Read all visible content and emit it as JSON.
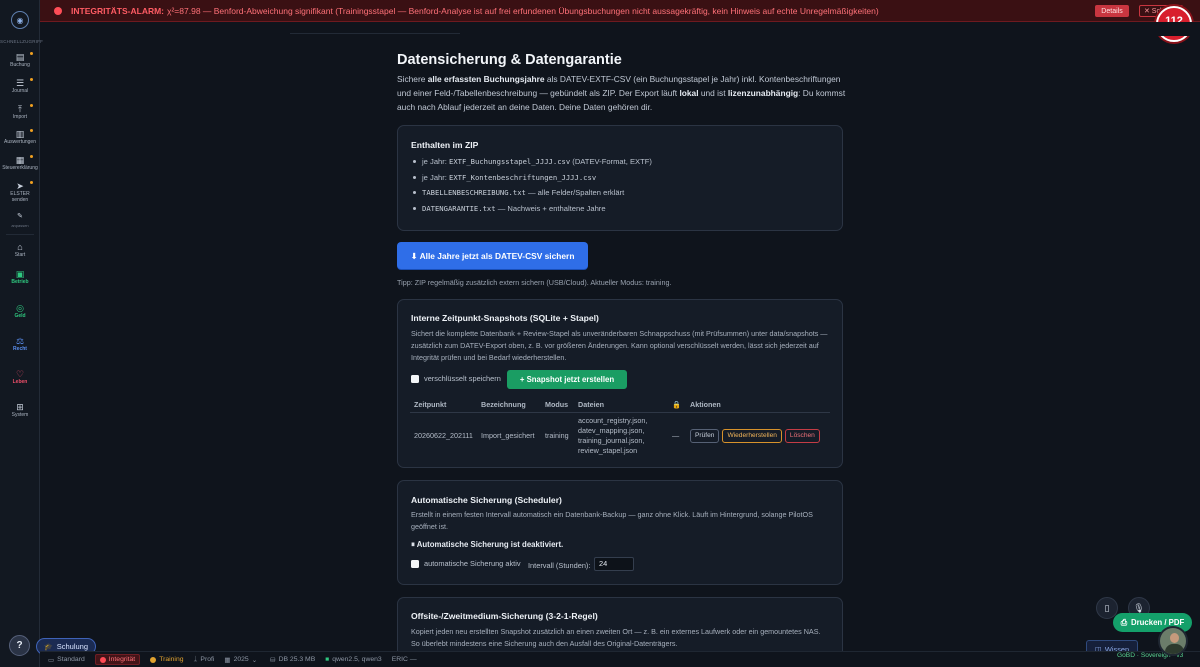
{
  "alarm": {
    "title": "INTEGRITÄTS-ALARM:",
    "message": "χ²=87.98 — Benford-Abweichung signifikant (Trainingsstapel — Benford-Analyse ist auf frei erfundenen Übungsbuchungen nicht aussagekräftig, kein Hinweis auf echte Unregelmäßigkeiten)",
    "details_label": "Details",
    "close_label": "✕ Schließen",
    "accent": "#ff4d57"
  },
  "notruf": {
    "number": "112",
    "label": "Notruf"
  },
  "sidebar": {
    "header": "SCHNELLZUGRIFF",
    "quick_items": [
      {
        "label": "Buchung",
        "icon": "document-icon"
      },
      {
        "label": "Journal",
        "icon": "list-icon"
      },
      {
        "label": "Import",
        "icon": "upload-icon"
      },
      {
        "label": "Auswertungen",
        "icon": "chart-icon"
      },
      {
        "label": "Steuererklärung",
        "icon": "form-icon"
      },
      {
        "label": "ELSTER senden",
        "icon": "send-icon"
      },
      {
        "label": "anpassen",
        "icon": "pencil-icon"
      }
    ],
    "nav_items": [
      {
        "label": "Start",
        "icon": "home-icon"
      },
      {
        "label": "Betrieb",
        "icon": "briefcase-icon",
        "color": "#2fc77f"
      },
      {
        "label": "Geld",
        "icon": "money-icon",
        "color": "#2fc77f"
      },
      {
        "label": "Recht",
        "icon": "scale-icon",
        "color": "#5b8ff0"
      },
      {
        "label": "Leben",
        "icon": "heart-pulse-icon",
        "color": "#ef4f6a"
      },
      {
        "label": "System",
        "icon": "grid-icon"
      }
    ]
  },
  "help_label": "?",
  "schulung_label": "Schulung",
  "page": {
    "title": "Datensicherung & Datengarantie",
    "intro_1": "Sichere ",
    "intro_b1": "alle erfassten Buchungsjahre",
    "intro_2": " als DATEV-EXTF-CSV (ein Buchungsstapel je Jahr) inkl. Kontenbeschriftungen und einer Feld-/Tabellenbeschreibung — gebündelt als ZIP. Der Export läuft ",
    "intro_b2": "lokal",
    "intro_3": " und ist ",
    "intro_b3": "lizenzunabhängig",
    "intro_4": ": Du kommst auch nach Ablauf jederzeit an deine Daten. Deine Daten gehören dir."
  },
  "zip_card": {
    "title": "Enthalten im ZIP",
    "items": [
      {
        "prefix": "je Jahr: ",
        "code": "EXTF_Buchungsstapel_JJJJ.csv",
        "suffix": " (DATEV-Format, EXTF)"
      },
      {
        "prefix": "je Jahr: ",
        "code": "EXTF_Kontenbeschriftungen_JJJJ.csv",
        "suffix": ""
      },
      {
        "prefix": "",
        "code": "TABELLENBESCHREIBUNG.txt",
        "suffix": " — alle Felder/Spalten erklärt"
      },
      {
        "prefix": "",
        "code": "DATENGARANTIE.txt",
        "suffix": " — Nachweis + enthaltene Jahre"
      }
    ]
  },
  "export_button": "⬇ Alle Jahre jetzt als DATEV-CSV sichern",
  "tipp": "Tipp: ZIP regelmäßig zusätzlich extern sichern (USB/Cloud). Aktueller Modus: training.",
  "snapshots": {
    "title": "Interne Zeitpunkt-Snapshots (SQLite + Stapel)",
    "desc": "Sichert die komplette Datenbank + Review-Stapel als unveränderbaren Schnappschuss (mit Prüfsummen) unter data/snapshots — zusätzlich zum DATEV-Export oben, z. B. vor größeren Änderungen. Kann optional verschlüsselt werden, lässt sich jederzeit auf Integrität prüfen und bei Bedarf wiederherstellen.",
    "encrypt_label": "verschlüsselt speichern",
    "create_button": "+ Snapshot jetzt erstellen",
    "columns": [
      "Zeitpunkt",
      "Bezeichnung",
      "Modus",
      "Dateien",
      "🔒",
      "Aktionen"
    ],
    "rows": [
      {
        "zeitpunkt": "20260622_202111",
        "bezeichnung": "Import_gesichert",
        "modus": "training",
        "dateien": [
          "account_registry.json,",
          "datev_mapping.json,",
          "training_journal.json,",
          "review_stapel.json"
        ],
        "lock": "—",
        "actions": [
          "Prüfen",
          "Wiederherstellen",
          "Löschen"
        ]
      }
    ]
  },
  "scheduler": {
    "title": "Automatische Sicherung (Scheduler)",
    "desc": "Erstellt in einem festen Intervall automatisch ein Datenbank-Backup — ganz ohne Klick. Läuft im Hintergrund, solange PilotOS geöffnet ist.",
    "status": "⏸ Automatische Sicherung ist deaktiviert.",
    "active_label": "automatische Sicherung aktiv",
    "interval_label": "Intervall (Stunden):",
    "interval_value": "24"
  },
  "offsite": {
    "title": "Offsite-/Zweitmedium-Sicherung (3-2-1-Regel)",
    "desc": "Kopiert jeden neu erstellten Snapshot zusätzlich an einen zweiten Ort — z. B. ein externes Laufwerk oder ein gemountetes NAS. So überlebt mindestens eine Sicherung auch den Ausfall des Original-Datenträgers."
  },
  "statusbar": {
    "standard": "Standard",
    "integritaet": "Integrität",
    "training": "Training",
    "profi": "Profi",
    "year": "2025",
    "db": "DB 25.3 MB",
    "models": "qwen2.5, qwen3",
    "eric": "ERIC —"
  },
  "drucken_label": "Drucken / PDF",
  "wissen_label": "Wissen",
  "gobd_label": "GoBD · Sovereign · v3"
}
